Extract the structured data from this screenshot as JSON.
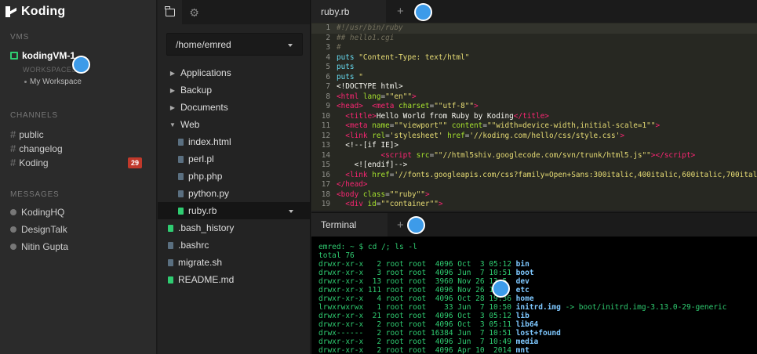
{
  "app": {
    "name": "Koding"
  },
  "sidebar": {
    "vms_title": "VMS",
    "vm_name": "kodingVM-1",
    "workspaces_title": "WORKSPACES",
    "workspace_item": "My Workspace",
    "channels_title": "CHANNELS",
    "channels": [
      {
        "label": "public",
        "badge": ""
      },
      {
        "label": "changelog",
        "badge": ""
      },
      {
        "label": "Koding",
        "badge": "29"
      }
    ],
    "messages_title": "MESSAGES",
    "messages": [
      {
        "label": "KodingHQ"
      },
      {
        "label": "DesignTalk"
      },
      {
        "label": "Nitin Gupta"
      }
    ],
    "colors": {
      "vm_status": "#2fcc71",
      "badge": "#c0392b"
    }
  },
  "filetree": {
    "tabs": [
      "folder-icon",
      "gear-icon"
    ],
    "path": "/home/emred",
    "items": [
      {
        "label": "Applications",
        "type": "folder",
        "state": "collapsed",
        "depth": 0
      },
      {
        "label": "Backup",
        "type": "folder",
        "state": "collapsed",
        "depth": 0
      },
      {
        "label": "Documents",
        "type": "folder",
        "state": "collapsed",
        "depth": 0
      },
      {
        "label": "Web",
        "type": "folder",
        "state": "expanded",
        "depth": 0
      },
      {
        "label": "index.html",
        "type": "file",
        "depth": 1
      },
      {
        "label": "perl.pl",
        "type": "file",
        "depth": 1
      },
      {
        "label": "php.php",
        "type": "file",
        "depth": 1
      },
      {
        "label": "python.py",
        "type": "file",
        "depth": 1
      },
      {
        "label": "ruby.rb",
        "type": "file",
        "depth": 1,
        "selected": true,
        "color": "green"
      },
      {
        "label": ".bash_history",
        "type": "file",
        "depth": 0,
        "color": "green"
      },
      {
        "label": ".bashrc",
        "type": "file",
        "depth": 0
      },
      {
        "label": "migrate.sh",
        "type": "file",
        "depth": 0
      },
      {
        "label": "README.md",
        "type": "file",
        "depth": 0,
        "color": "green"
      }
    ]
  },
  "editor": {
    "tab": "ruby.rb",
    "lines": [
      {
        "n": "1",
        "html": "<span class='c-com'>#!/usr/bin/ruby</span>"
      },
      {
        "n": "2",
        "html": "<span class='c-com'>## hello1.cgi</span>"
      },
      {
        "n": "3",
        "html": "<span class='c-com'>#</span>"
      },
      {
        "n": "4",
        "html": "<span class='c-fn'>puts</span> <span class='c-str'>\"Content-Type: text/html\"</span>"
      },
      {
        "n": "5",
        "html": "<span class='c-fn'>puts</span>"
      },
      {
        "n": "6",
        "html": "<span class='c-fn'>puts</span> <span class='c-str'>\"</span>"
      },
      {
        "n": "7",
        "html": "<span class='c-txt'>&lt;!DOCTYPE html&gt;</span>"
      },
      {
        "n": "8",
        "html": "<span class='c-tag'>&lt;html</span> <span class='c-att'>lang</span>=<span class='c-str'>\"\"en\"\"</span><span class='c-tag'>&gt;</span>"
      },
      {
        "n": "9",
        "html": "<span class='c-tag'>&lt;head&gt;</span>  <span class='c-tag'>&lt;meta</span> <span class='c-att'>charset</span>=<span class='c-str'>\"\"utf-8\"\"</span><span class='c-tag'>&gt;</span>"
      },
      {
        "n": "10",
        "html": "  <span class='c-tag'>&lt;title&gt;</span><span class='c-txt'>Hello World from Ruby by Koding</span><span class='c-tag'>&lt;/title&gt;</span>"
      },
      {
        "n": "11",
        "html": "  <span class='c-tag'>&lt;meta</span> <span class='c-att'>name</span>=<span class='c-str'>\"\"viewport\"\"</span> <span class='c-att'>content</span>=<span class='c-str'>\"\"width=device-width,initial-scale=1\"\"</span><span class='c-tag'>&gt;</span>"
      },
      {
        "n": "12",
        "html": "  <span class='c-tag'>&lt;link</span> <span class='c-att'>rel</span>=<span class='c-str'>'stylesheet'</span> <span class='c-att'>href</span>=<span class='c-str'>'//koding.com/hello/css/style.css'</span><span class='c-tag'>&gt;</span>"
      },
      {
        "n": "13",
        "html": "  <span class='c-txt'>&lt;!--[if IE]&gt;</span>"
      },
      {
        "n": "14",
        "html": "          <span class='c-tag'>&lt;script</span> <span class='c-att'>src</span>=<span class='c-str'>\"\"//html5shiv.googlecode.com/svn/trunk/html5.js\"\"</span><span class='c-tag'>&gt;&lt;/script&gt;</span>"
      },
      {
        "n": "15",
        "html": "    <span class='c-txt'>&lt;![endif]--&gt;</span>"
      },
      {
        "n": "16",
        "html": "  <span class='c-tag'>&lt;link</span> <span class='c-att'>href</span>=<span class='c-str'>'//fonts.googleapis.com/css?family=Open+Sans:300italic,400italic,600italic,700italic</span>"
      },
      {
        "n": "17",
        "html": "<span class='c-tag'>&lt;/head&gt;</span>"
      },
      {
        "n": "18",
        "html": "<span class='c-tag'>&lt;body</span> <span class='c-att'>class</span>=<span class='c-str'>\"\"ruby\"\"</span><span class='c-tag'>&gt;</span>"
      },
      {
        "n": "19",
        "html": "  <span class='c-tag'>&lt;div</span> <span class='c-att'>id</span>=<span class='c-str'>\"\"container\"\"</span><span class='c-tag'>&gt;</span>"
      }
    ]
  },
  "terminal": {
    "tab": "Terminal",
    "prompt": "emred: ~ $ cd /; ls -l",
    "total": "total 76",
    "rows": [
      {
        "meta": "drwxr-xr-x   2 root root  4096 Oct  3 05:12 ",
        "name": "bin",
        "kind": "dir"
      },
      {
        "meta": "drwxr-xr-x   3 root root  4096 Jun  7 10:51 ",
        "name": "boot",
        "kind": "dir"
      },
      {
        "meta": "drwxr-xr-x  13 root root  3960 Nov 26 13:5  ",
        "name": "dev",
        "kind": "dir"
      },
      {
        "meta": "drwxr-xr-x 111 root root  4096 Nov 26 13:   ",
        "name": "etc",
        "kind": "dir"
      },
      {
        "meta": "drwxr-xr-x   4 root root  4096 Oct 28 19:36 ",
        "name": "home",
        "kind": "dir"
      },
      {
        "meta": "lrwxrwxrwx   1 root root    33 Jun  7 10:50 ",
        "name": "initrd.img",
        "kind": "link",
        "target": " -> boot/initrd.img-3.13.0-29-generic"
      },
      {
        "meta": "drwxr-xr-x  21 root root  4096 Oct  3 05:12 ",
        "name": "lib",
        "kind": "dir"
      },
      {
        "meta": "drwxr-xr-x   2 root root  4096 Oct  3 05:11 ",
        "name": "lib64",
        "kind": "dir"
      },
      {
        "meta": "drwx------   2 root root 16384 Jun  7 10:51 ",
        "name": "lost+found",
        "kind": "dir"
      },
      {
        "meta": "drwxr-xr-x   2 root root  4096 Jun  7 10:49 ",
        "name": "media",
        "kind": "dir"
      },
      {
        "meta": "drwxr-xr-x   2 root root  4096 Apr 10  2014 ",
        "name": "mnt",
        "kind": "dir"
      }
    ]
  }
}
